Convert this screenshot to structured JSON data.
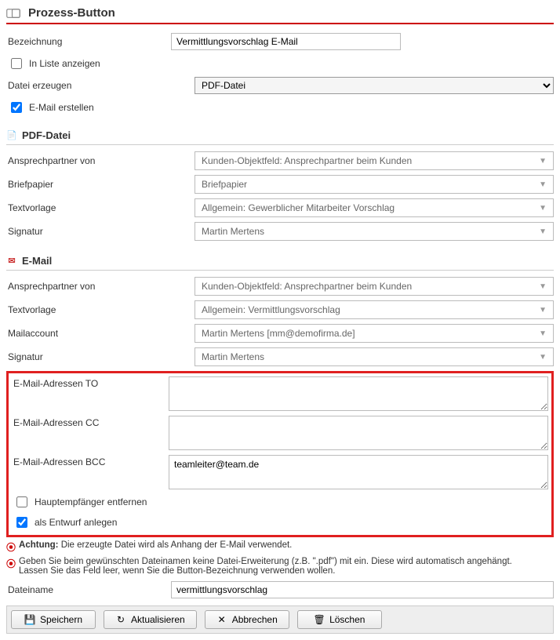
{
  "title": "Prozess-Button",
  "fields": {
    "bezeichnung_label": "Bezeichnung",
    "bezeichnung_value": "Vermittlungsvorschlag E-Mail",
    "in_liste_label": "In Liste anzeigen",
    "in_liste_checked": false,
    "datei_erzeugen_label": "Datei erzeugen",
    "datei_erzeugen_value": "PDF-Datei",
    "email_erstellen_label": "E-Mail erstellen",
    "email_erstellen_checked": true
  },
  "pdf": {
    "section_title": "PDF-Datei",
    "ansprech_label": "Ansprechpartner von",
    "ansprech_value": "Kunden-Objektfeld: Ansprechpartner beim Kunden",
    "briefpapier_label": "Briefpapier",
    "briefpapier_value": "Briefpapier",
    "textvorlage_label": "Textvorlage",
    "textvorlage_value": "Allgemein: Gewerblicher Mitarbeiter Vorschlag",
    "signatur_label": "Signatur",
    "signatur_value": "Martin Mertens"
  },
  "email": {
    "section_title": "E-Mail",
    "ansprech_label": "Ansprechpartner von",
    "ansprech_value": "Kunden-Objektfeld: Ansprechpartner beim Kunden",
    "textvorlage_label": "Textvorlage",
    "textvorlage_value": "Allgemein: Vermittlungsvorschlag",
    "mailaccount_label": "Mailaccount",
    "mailaccount_value": "Martin Mertens [mm@demofirma.de]",
    "signatur_label": "Signatur",
    "signatur_value": "Martin Mertens",
    "to_label": "E-Mail-Adressen TO",
    "to_value": "",
    "cc_label": "E-Mail-Adressen CC",
    "cc_value": "",
    "bcc_label": "E-Mail-Adressen BCC",
    "bcc_value": "teamleiter@team.de",
    "haupt_label": "Hauptempfänger entfernen",
    "haupt_checked": false,
    "entwurf_label": "als Entwurf anlegen",
    "entwurf_checked": true
  },
  "notices": {
    "achtung_prefix": "Achtung:",
    "achtung_text": "Die erzeugte Datei wird als Anhang der E-Mail verwendet.",
    "hint1": "Geben Sie beim gewünschten Dateinamen keine Datei-Erweiterung (z.B. \".pdf\") mit ein. Diese wird automatisch angehängt.",
    "hint2": "Lassen Sie das Feld leer, wenn Sie die Button-Bezeichnung verwenden wollen."
  },
  "dateiname": {
    "label": "Dateiname",
    "value": "vermittlungsvorschlag"
  },
  "buttons": {
    "save": "Speichern",
    "refresh": "Aktualisieren",
    "cancel": "Abbrechen",
    "delete": "Löschen"
  }
}
